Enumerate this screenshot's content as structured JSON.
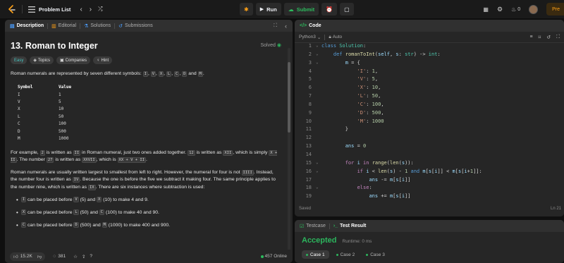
{
  "topbar": {
    "problem_list": "Problem List",
    "run": "Run",
    "submit": "Submit",
    "streak": "0",
    "premium": "Pre"
  },
  "description": {
    "tabs": [
      {
        "label": "Description"
      },
      {
        "label": "Editorial"
      },
      {
        "label": "Solutions"
      },
      {
        "label": "Submissions"
      }
    ],
    "title": "13. Roman to Integer",
    "solved": "Solved",
    "chips": {
      "difficulty": "Easy",
      "topics": "Topics",
      "companies": "Companies",
      "hint": "Hint"
    },
    "intro_prefix": "Roman numerals are represented by seven different symbols: ",
    "symbols": [
      "I",
      "V",
      "X",
      "L",
      "C",
      "D",
      "M"
    ],
    "intro_sep": ", ",
    "intro_and": " and ",
    "intro_end": ".",
    "table": {
      "header": [
        "Symbol",
        "Value"
      ],
      "rows": [
        [
          "I",
          "1"
        ],
        [
          "V",
          "5"
        ],
        [
          "X",
          "10"
        ],
        [
          "L",
          "50"
        ],
        [
          "C",
          "100"
        ],
        [
          "D",
          "500"
        ],
        [
          "M",
          "1000"
        ]
      ]
    },
    "p2": {
      "a": "For example, ",
      "c1": "2",
      "b": " is written as ",
      "c2": "II",
      "c": " in Roman numeral, just two ones added together. ",
      "c3": "12",
      "d": " is written as ",
      "c4": "XII",
      "e": ", which is simply ",
      "c5": "X + II",
      "f": ". The number ",
      "c6": "27",
      "g": " is written as ",
      "c7": "XXVII",
      "h": ", which is ",
      "c8": "XX + V + II",
      "i": "."
    },
    "p3": {
      "a": "Roman numerals are usually written largest to smallest from left to right. However, the numeral for four is not ",
      "c1": "IIII",
      "b": ". Instead, the number four is written as ",
      "c2": "IV",
      "c": ". Because the one is before the five we subtract it making four. The same principle applies to the number nine, which is written as ",
      "c3": "IX",
      "d": ". There are six instances where subtraction is used:"
    },
    "bullets": [
      {
        "c1": "I",
        "a": " can be placed before ",
        "c2": "V",
        "b": " (5) and ",
        "c3": "X",
        "c": " (10) to make 4 and 9."
      },
      {
        "c1": "X",
        "a": " can be placed before ",
        "c2": "L",
        "b": " (50) and ",
        "c3": "C",
        "c": " (100) to make 40 and 90."
      },
      {
        "c1": "C",
        "a": " can be placed before ",
        "c2": "D",
        "b": " (500) and ",
        "c3": "M",
        "c": " (1000) to make 400 and 900."
      }
    ],
    "footer": {
      "likes": "15.2K",
      "comments": "381",
      "online": "457 Online"
    }
  },
  "code": {
    "tab": "Code",
    "language": "Python3",
    "auto": "Auto",
    "lines": [
      "1",
      "2",
      "3",
      "4",
      "5",
      "6",
      "7",
      "8",
      "9",
      "10",
      "11",
      "12",
      "13",
      "14",
      "15",
      "16",
      "17",
      "18",
      "19"
    ],
    "saved": "Saved",
    "position": "Ln 21"
  },
  "test": {
    "tab_testcase": "Testcase",
    "tab_result": "Test Result",
    "status": "Accepted",
    "runtime": "Runtime: 0 ms",
    "cases": [
      "Case 1",
      "Case 2",
      "Case 3"
    ]
  },
  "colors": {
    "accent": "#ffa116",
    "accepted": "#2cb55d",
    "easy": "#46c6c2",
    "submit": "#2cbb5d"
  }
}
